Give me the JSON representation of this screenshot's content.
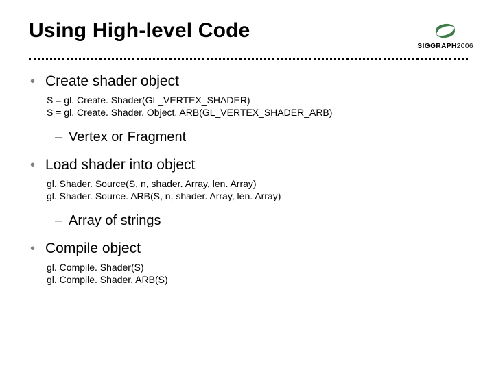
{
  "title": "Using High-level Code",
  "logo": {
    "brand": "SIGGRAPH",
    "year": "2006"
  },
  "items": [
    {
      "heading": "Create shader object",
      "code": [
        "S = gl. Create. Shader(GL_VERTEX_SHADER)",
        "S = gl. Create. Shader. Object. ARB(GL_VERTEX_SHADER_ARB)"
      ],
      "sub": "Vertex or Fragment"
    },
    {
      "heading": "Load shader into object",
      "code": [
        "gl. Shader. Source(S, n, shader. Array, len. Array)",
        "gl. Shader. Source. ARB(S, n, shader. Array, len. Array)"
      ],
      "sub": "Array of strings"
    },
    {
      "heading": "Compile object",
      "code": [
        "gl. Compile. Shader(S)",
        "gl. Compile. Shader. ARB(S)"
      ],
      "sub": null
    }
  ]
}
